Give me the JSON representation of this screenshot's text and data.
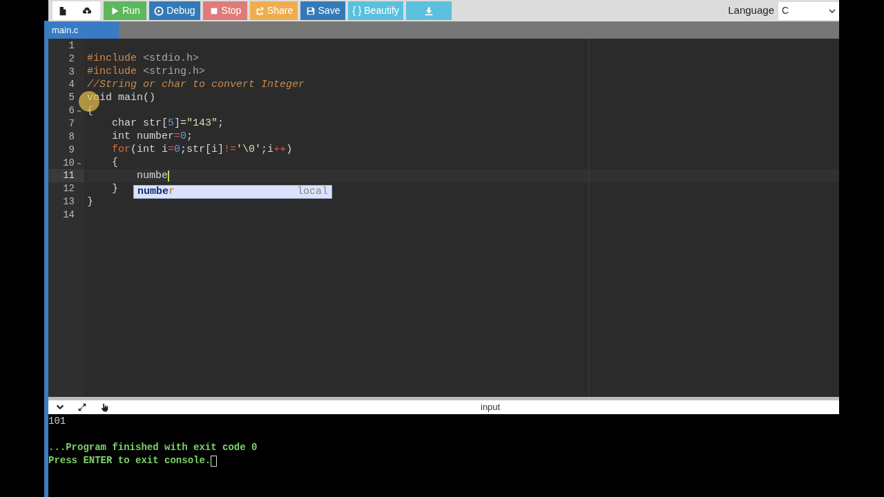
{
  "toolbar": {
    "buttons": [
      {
        "kind": "new-file",
        "color": "#ffffff",
        "disabled": false
      },
      {
        "kind": "upload",
        "color": "#ffffff",
        "disabled": false
      },
      {
        "kind": "run",
        "label": "Run",
        "color": "#5cb85c",
        "disabled": false
      },
      {
        "kind": "debug",
        "label": "Debug",
        "color": "#337ab7",
        "disabled": false
      },
      {
        "kind": "stop",
        "label": "Stop",
        "color": "#e07b79",
        "disabled": false
      },
      {
        "kind": "share",
        "label": "Share",
        "color": "#f0ad4e",
        "disabled": false
      },
      {
        "kind": "save",
        "label": "Save",
        "color": "#337ab7",
        "disabled": false
      },
      {
        "kind": "beautify",
        "label": "{ } Beautify",
        "color": "#5bc0de",
        "disabled": false
      },
      {
        "kind": "download",
        "color": "#5bc0de",
        "disabled": false
      }
    ],
    "language": {
      "label": "Language",
      "value": "C"
    }
  },
  "tabs": [
    {
      "label": "main.c",
      "selected": true
    }
  ],
  "editor": {
    "lines": [
      {
        "number": "1",
        "foldable": false,
        "active": false
      },
      {
        "number": "2",
        "foldable": false,
        "active": false,
        "tokens": [
          {
            "kind": "preproc",
            "text": "#include "
          },
          {
            "kind": "header",
            "text": "<stdio.h>"
          }
        ]
      },
      {
        "number": "3",
        "foldable": false,
        "active": false,
        "tokens": [
          {
            "kind": "preproc",
            "text": "#include "
          },
          {
            "kind": "header",
            "text": "<string.h>"
          }
        ]
      },
      {
        "number": "4",
        "foldable": false,
        "active": false,
        "tokens": [
          {
            "kind": "comment",
            "text": "//String or char to convert Integer"
          }
        ]
      },
      {
        "number": "5",
        "foldable": false,
        "active": false,
        "tokens": [
          {
            "kind": "plain",
            "text": "void main()"
          }
        ]
      },
      {
        "number": "6",
        "foldable": true,
        "active": false,
        "tokens": [
          {
            "kind": "plain",
            "text": "{"
          }
        ]
      },
      {
        "number": "7",
        "foldable": false,
        "active": false,
        "tokens": [
          {
            "kind": "plain",
            "text": "    char str["
          },
          {
            "kind": "number",
            "text": "5"
          },
          {
            "kind": "plain",
            "text": "]="
          },
          {
            "kind": "string",
            "text": "\"143\""
          },
          {
            "kind": "plain",
            "text": ";"
          }
        ]
      },
      {
        "number": "8",
        "foldable": false,
        "active": false,
        "tokens": [
          {
            "kind": "plain",
            "text": "    int number"
          },
          {
            "kind": "operator",
            "text": "="
          },
          {
            "kind": "number",
            "text": "0"
          },
          {
            "kind": "plain",
            "text": ";"
          }
        ]
      },
      {
        "number": "9",
        "foldable": false,
        "active": false,
        "tokens": [
          {
            "kind": "keyword",
            "text": "    for"
          },
          {
            "kind": "plain",
            "text": "(int i"
          },
          {
            "kind": "operator",
            "text": "="
          },
          {
            "kind": "number",
            "text": "0"
          },
          {
            "kind": "plain",
            "text": ";str[i]"
          },
          {
            "kind": "operator",
            "text": "!="
          },
          {
            "kind": "string",
            "text": "'\\0'"
          },
          {
            "kind": "plain",
            "text": ";i"
          },
          {
            "kind": "operator",
            "text": "++"
          },
          {
            "kind": "plain",
            "text": ")"
          }
        ]
      },
      {
        "number": "10",
        "foldable": true,
        "active": false,
        "tokens": [
          {
            "kind": "plain",
            "text": "    {"
          }
        ]
      },
      {
        "number": "11",
        "foldable": false,
        "active": true,
        "tokens": [
          {
            "kind": "plain",
            "text": "        numbe"
          }
        ]
      },
      {
        "number": "12",
        "foldable": false,
        "active": false,
        "tokens": [
          {
            "kind": "plain",
            "text": "    }"
          }
        ]
      },
      {
        "number": "13",
        "foldable": false,
        "active": false,
        "tokens": [
          {
            "kind": "plain",
            "text": "}"
          }
        ]
      },
      {
        "number": "14",
        "foldable": false,
        "active": false
      }
    ],
    "autocomplete": {
      "match": "numbe",
      "rest": "r",
      "type": "local"
    }
  },
  "console": {
    "header": "input",
    "output": "101",
    "messages": [
      "...Program finished with exit code 0",
      "Press ENTER to exit console."
    ]
  }
}
